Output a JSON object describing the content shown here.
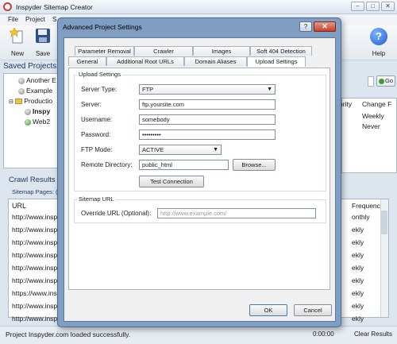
{
  "app": {
    "title": "Inspyder Sitemap Creator",
    "window_controls": [
      "–",
      "□",
      "✕"
    ]
  },
  "menu": [
    "File",
    "Project",
    "S"
  ],
  "toolbar": {
    "new_label": "New",
    "save_label": "Save",
    "help_label": "Help"
  },
  "saved_projects": {
    "title": "Saved Projects",
    "items": [
      "Another E",
      "Example",
      "Productio",
      "Inspy",
      "Web2"
    ]
  },
  "right_panel": {
    "go_label": "Go",
    "columns": [
      "ority",
      "Change F"
    ],
    "rows": [
      "Weekly",
      "Never"
    ]
  },
  "crawl_results": {
    "title": "Crawl Results",
    "tab_label": "Sitemap Pages: (",
    "url_header": "URL",
    "freq_header": "Frequency",
    "rows": [
      {
        "url": "http://www.insp",
        "freq": "onthly"
      },
      {
        "url": "http://www.insp",
        "freq": "ekly"
      },
      {
        "url": "http://www.insp",
        "freq": "ekly"
      },
      {
        "url": "http://www.insp",
        "freq": "ekly"
      },
      {
        "url": "http://www.insp",
        "freq": "ekly"
      },
      {
        "url": "http://www.insp",
        "freq": "ekly"
      },
      {
        "url": "https://www.ins",
        "freq": "ekly"
      },
      {
        "url": "http://www.insp",
        "freq": "ekly"
      },
      {
        "url": "http://www.insp",
        "freq": "ekly"
      }
    ]
  },
  "status": {
    "message": "Project Inspyder.com loaded successfully.",
    "count": "0:00:00",
    "clear": "Clear Results"
  },
  "dialog": {
    "title": "Advanced Project Settings",
    "help": "?",
    "close": "✕",
    "tabs_row1": [
      "Parameter Removal",
      "Crawler",
      "Images",
      "Soft 404 Detection"
    ],
    "tabs_row2": [
      "General",
      "Additional Root URLs",
      "Domain Aliases",
      "Upload Settings"
    ],
    "upload": {
      "group_title": "Upload Settings",
      "server_type_label": "Server Type:",
      "server_type_value": "FTP",
      "server_label": "Server:",
      "server_value": "ftp.yoursite.com",
      "username_label": "Username:",
      "username_value": "somebody",
      "password_label": "Password:",
      "password_value": "•••••••••",
      "ftp_mode_label": "FTP Mode:",
      "ftp_mode_value": "ACTIVE",
      "remote_dir_label": "Remote Directory:",
      "remote_dir_value": "public_html",
      "browse_label": "Browse...",
      "test_connection_label": "Test Connection"
    },
    "sitemap_url": {
      "group_title": "Sitemap URL",
      "override_label": "Override URL (Optional):",
      "override_placeholder": "http://www.example.com/"
    },
    "ok_label": "OK",
    "cancel_label": "Cancel"
  }
}
